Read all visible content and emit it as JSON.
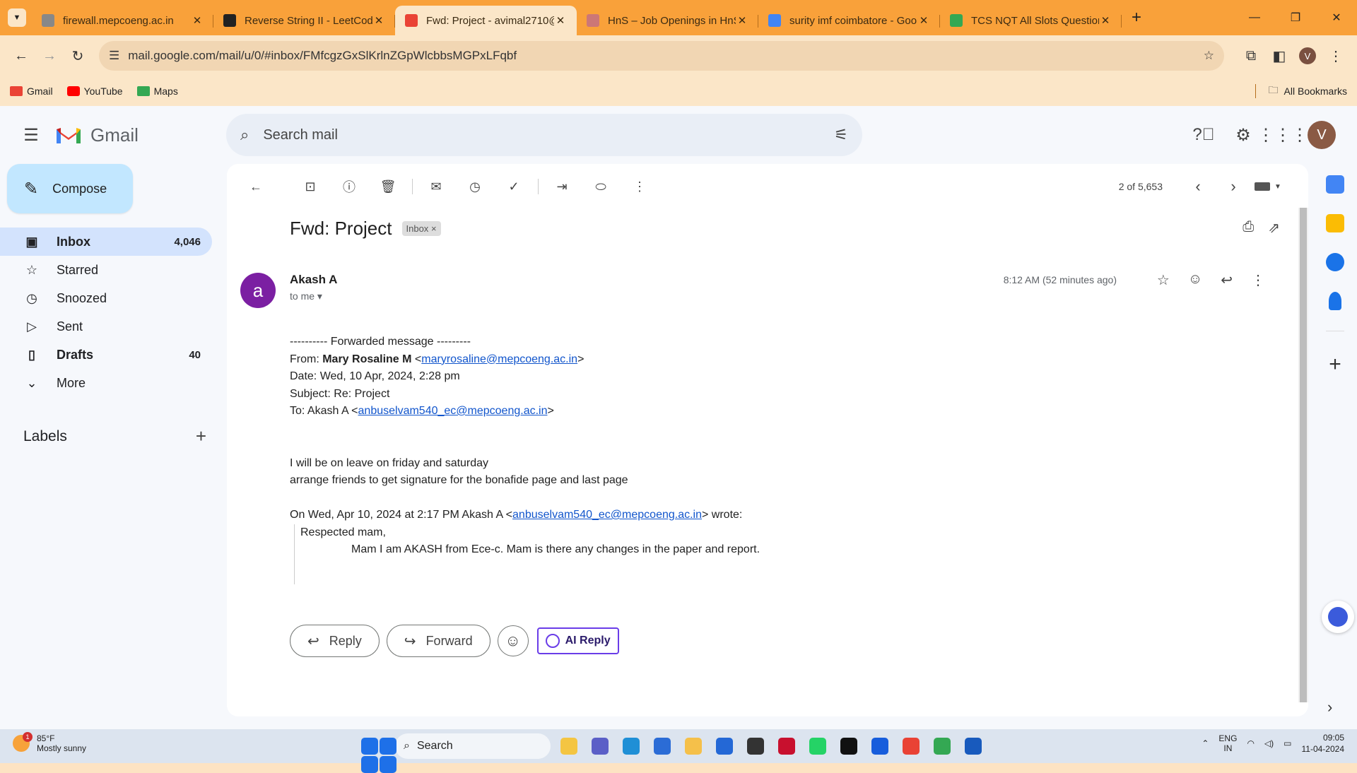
{
  "browser": {
    "tabs": [
      {
        "title": "firewall.mepcoeng.ac.in",
        "icon": "s-icon",
        "active": false
      },
      {
        "title": "Reverse String II - LeetCode",
        "icon": "leetcode-icon",
        "active": false
      },
      {
        "title": "Fwd: Project - avimal2710@",
        "icon": "gmail-icon",
        "active": true
      },
      {
        "title": "HnS – Job Openings in HnS",
        "icon": "hns-icon",
        "active": false
      },
      {
        "title": "surity imf coimbatore - Goo",
        "icon": "google-icon",
        "active": false
      },
      {
        "title": "TCS NQT All Slots Question",
        "icon": "drive-icon",
        "active": false
      }
    ],
    "url": "mail.google.com/mail/u/0/#inbox/FMfcgzGxSlKrlnZGpWlcbbsMGPxLFqbf",
    "profile_letter": "V",
    "bookmarks": [
      {
        "label": "Gmail",
        "color": "#ea4335"
      },
      {
        "label": "YouTube",
        "color": "#ff0000"
      },
      {
        "label": "Maps",
        "color": "#34a853"
      }
    ],
    "all_bookmarks": "All Bookmarks",
    "accent": "#f9a13a"
  },
  "gmail": {
    "logo_text": "Gmail",
    "search_placeholder": "Search mail",
    "avatar_letter": "V",
    "compose_label": "Compose",
    "nav": [
      {
        "label": "Inbox",
        "count": "4,046",
        "icon": "inbox-icon",
        "active": true,
        "bold": true
      },
      {
        "label": "Starred",
        "count": "",
        "icon": "star-icon",
        "active": false,
        "bold": false
      },
      {
        "label": "Snoozed",
        "count": "",
        "icon": "clock-icon",
        "active": false,
        "bold": false
      },
      {
        "label": "Sent",
        "count": "",
        "icon": "send-icon",
        "active": false,
        "bold": false
      },
      {
        "label": "Drafts",
        "count": "40",
        "icon": "draft-icon",
        "active": false,
        "bold": true
      },
      {
        "label": "More",
        "count": "",
        "icon": "chevron-down-icon",
        "active": false,
        "bold": false
      }
    ],
    "labels_heading": "Labels",
    "pager_text": "2 of 5,653",
    "email": {
      "subject": "Fwd: Project",
      "tag": "Inbox",
      "sender_initial": "a",
      "sender_name": "Akash A",
      "to_line": "to me",
      "time": "8:12 AM (52 minutes ago)",
      "fwd_header": "---------- Forwarded message ---------",
      "from_label": "From: ",
      "from_name": "Mary Rosaline M",
      "from_email": "maryrosaline@mepcoeng.ac.in",
      "date_line": "Date: Wed, 10 Apr, 2024, 2:28 pm",
      "subject_line": "Subject: Re: Project",
      "to_label": "To: Akash A <",
      "to_email": "anbuselvam540_ec@mepcoeng.ac.in",
      "body_1": "I will be on leave on friday and saturday",
      "body_2": "arrange friends to get signature for the bonafide page and last page",
      "quote_prefix": "On Wed, Apr 10, 2024 at 2:17 PM Akash A <",
      "quote_email": "anbuselvam540_ec@mepcoeng.ac.in",
      "quote_suffix": "> wrote:",
      "quote_1": "Respected mam,",
      "quote_2": "Mam I am AKASH from Ece-c. Mam is there any changes in the paper and report."
    },
    "buttons": {
      "reply": "Reply",
      "forward": "Forward",
      "ai_reply": "AI Reply"
    }
  },
  "taskbar": {
    "temp": "85°F",
    "weather": "Mostly sunny",
    "weather_badge": "1",
    "search": "Search",
    "lang_1": "ENG",
    "lang_2": "IN",
    "time": "09:05",
    "date": "11-04-2024",
    "apps": [
      {
        "name": "file-explorer-icon",
        "color": "#f4c542"
      },
      {
        "name": "teams-icon",
        "color": "#5b5fc7"
      },
      {
        "name": "edge-icon",
        "color": "#1f8fd6"
      },
      {
        "name": "store-icon",
        "color": "#2b6cd6"
      },
      {
        "name": "folder-icon",
        "color": "#f5c04a"
      },
      {
        "name": "vscode-icon",
        "color": "#2468d6"
      },
      {
        "name": "terminal-icon",
        "color": "#333"
      },
      {
        "name": "mcafee-icon",
        "color": "#c8102e"
      },
      {
        "name": "whatsapp-icon",
        "color": "#25d366"
      },
      {
        "name": "cmd-icon",
        "color": "#111"
      },
      {
        "name": "bitwarden-icon",
        "color": "#175ddc"
      },
      {
        "name": "chrome-icon",
        "color": "#e94235"
      },
      {
        "name": "chrome-profile-icon",
        "color": "#34a853"
      },
      {
        "name": "word-icon",
        "color": "#185abd"
      }
    ]
  }
}
